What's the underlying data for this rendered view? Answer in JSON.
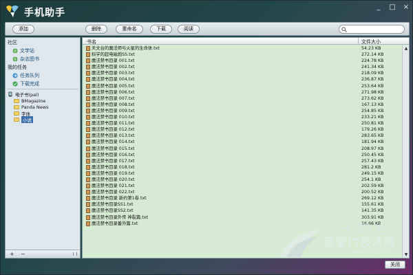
{
  "app": {
    "title": "手机助手",
    "window_controls": {
      "minimize": "_",
      "maximize": "□",
      "close": "×"
    }
  },
  "toolbar": {
    "add_label": "添加",
    "delete_label": "删除",
    "rename_label": "重命名",
    "download_label": "下载",
    "read_label": "阅读",
    "search_placeholder": ""
  },
  "sidebar": {
    "section_community": "社区",
    "community_items": [
      {
        "label": "文学站",
        "icon": "globe-icon"
      },
      {
        "label": "杂志图书",
        "icon": "globe-icon"
      }
    ],
    "section_tasks": "我的任务",
    "task_items": [
      {
        "label": "任务队列",
        "icon": "queue-icon"
      },
      {
        "label": "下载完成",
        "icon": "check-icon"
      }
    ],
    "tree_root": "电子书(pal)",
    "tree_children": [
      "BMagazine",
      "Panda News",
      "字体",
      "小说"
    ],
    "tree_selected": "小说",
    "bottom_add": "+",
    "bottom_remove": "−"
  },
  "list": {
    "col_name": "书名",
    "col_size": "文件大小",
    "rows": [
      {
        "name": "天文台的魔法师与火星的生命体.txt",
        "size": "54.23 KB"
      },
      {
        "name": "科学的超电磁炮SS.txt",
        "size": "272.14 KB"
      },
      {
        "name": "魔法禁书目录 001.txt",
        "size": "224.78 KB"
      },
      {
        "name": "魔法禁书目录 002.txt",
        "size": "241.34 KB"
      },
      {
        "name": "魔法禁书目录 003.txt",
        "size": "218.09 KB"
      },
      {
        "name": "魔法禁书目录 004.txt",
        "size": "236.87 KB"
      },
      {
        "name": "魔法禁书目录 005.txt",
        "size": "253.64 KB"
      },
      {
        "name": "魔法禁书目录 006.txt",
        "size": "271.98 KB"
      },
      {
        "name": "魔法禁书目录 007.txt",
        "size": "273.62 KB"
      },
      {
        "name": "魔法禁书目录 008.txt",
        "size": "167.13 KB"
      },
      {
        "name": "魔法禁书目录 009.txt",
        "size": "254.85 KB"
      },
      {
        "name": "魔法禁书目录 010.txt",
        "size": "233.21 KB"
      },
      {
        "name": "魔法禁书目录 011.txt",
        "size": "250.81 KB"
      },
      {
        "name": "魔法禁书目录 012.txt",
        "size": "179.26 KB"
      },
      {
        "name": "魔法禁书目录 013.txt",
        "size": "283.65 KB"
      },
      {
        "name": "魔法禁书目录 014.txt",
        "size": "181.94 KB"
      },
      {
        "name": "魔法禁书目录 015.txt",
        "size": "208.97 KB"
      },
      {
        "name": "魔法禁书目录 016.txt",
        "size": "250.45 KB"
      },
      {
        "name": "魔法禁书目录 017.txt",
        "size": "257.43 KB"
      },
      {
        "name": "魔法禁书目录 018.txt",
        "size": "281.2 KB"
      },
      {
        "name": "魔法禁书目录 019.txt",
        "size": "249.15 KB"
      },
      {
        "name": "魔法禁书目录 020.txt",
        "size": "254.1 KB"
      },
      {
        "name": "魔法禁书目录 021.txt",
        "size": "202.59 KB"
      },
      {
        "name": "魔法禁书目录 022.txt",
        "size": "200.52 KB"
      },
      {
        "name": "魔法禁书目录 新约第1卷.txt",
        "size": "269.12 KB"
      },
      {
        "name": "魔法禁书目录SS1.txt",
        "size": "155.61 KB"
      },
      {
        "name": "魔法禁书目录SS2.txt",
        "size": "141.35 KB"
      },
      {
        "name": "魔法禁书目录外传 神裂篇.txt",
        "size": "303.91 KB"
      },
      {
        "name": "魔法禁书目录番外篇.txt",
        "size": "16.66 KB"
      }
    ]
  },
  "watermark": {
    "line1": "十四冶",
    "line2": "我爱IT技术网",
    "line3": "www.52ij.com"
  },
  "footer": {
    "close_label": "关闭"
  }
}
